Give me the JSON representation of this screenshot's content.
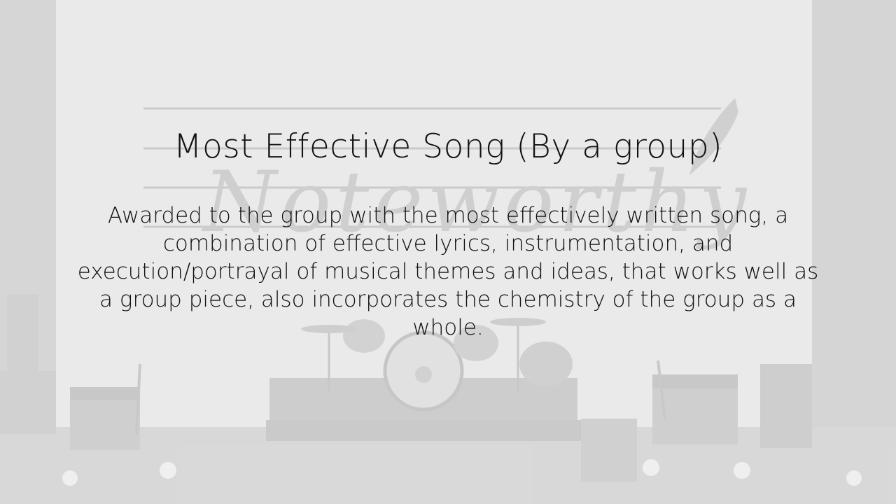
{
  "slide": {
    "title": "Most Effective Song (By a group)",
    "description": "Awarded to the group with the most effectively written song, a combination of effective lyrics, instrumentation, and execution/portrayal of musical themes and ideas, that works well as a group piece, also incorporates the chemistry of the group as a whole.",
    "background_logo": "Noteworthy",
    "background_scene": "stage-with-drum-kit-and-amplifiers",
    "colors": {
      "text": "#111111",
      "background": "#e6e6e6"
    }
  }
}
